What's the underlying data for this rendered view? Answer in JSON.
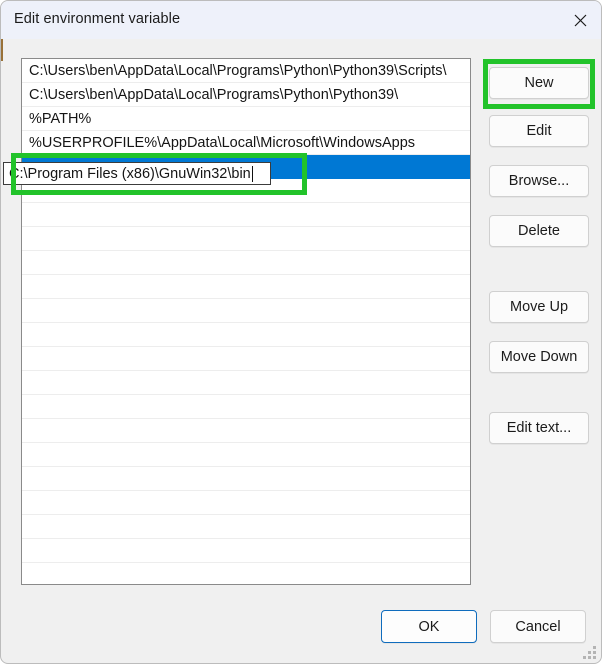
{
  "window": {
    "title": "Edit environment variable",
    "close_icon": "close-icon",
    "accent_color": "#0078d4",
    "annotation_color": "#22c32a"
  },
  "list": {
    "items": [
      "C:\\Users\\ben\\AppData\\Local\\Programs\\Python\\Python39\\Scripts\\",
      "C:\\Users\\ben\\AppData\\Local\\Programs\\Python\\Python39\\",
      "%PATH%",
      "%USERPROFILE%\\AppData\\Local\\Microsoft\\WindowsApps"
    ],
    "selected_index": 4,
    "selected_row_value": "",
    "empty_rows": 17
  },
  "editor": {
    "value": "C:\\Program Files (x86)\\GnuWin32\\bin",
    "caret_visible": true
  },
  "side_buttons": {
    "new": "New",
    "edit": "Edit",
    "browse": "Browse...",
    "delete": "Delete",
    "move_up": "Move Up",
    "move_down": "Move Down",
    "edit_text": "Edit text..."
  },
  "footer": {
    "ok": "OK",
    "cancel": "Cancel"
  },
  "annotations": [
    {
      "name": "new-button-highlight",
      "target": "New"
    },
    {
      "name": "inline-edit-highlight",
      "target": "C:\\Program Files (x86)\\GnuWin32\\bin"
    }
  ]
}
